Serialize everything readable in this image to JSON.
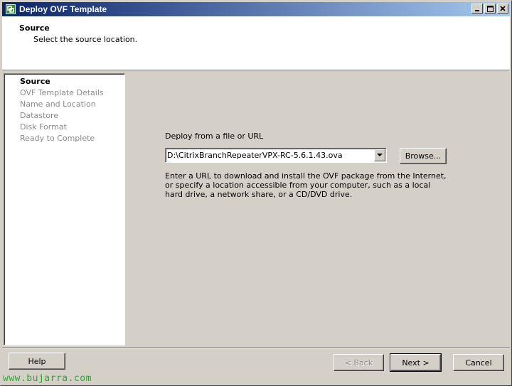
{
  "window": {
    "title": "Deploy OVF Template",
    "icon": "ovf-deploy-icon",
    "controls": [
      "minimize",
      "maximize",
      "close"
    ]
  },
  "header": {
    "title": "Source",
    "subtitle": "Select the source location."
  },
  "steps": [
    {
      "label": "Source",
      "active": true
    },
    {
      "label": "OVF Template Details",
      "active": false
    },
    {
      "label": "Name and Location",
      "active": false
    },
    {
      "label": "Datastore",
      "active": false
    },
    {
      "label": "Disk Format",
      "active": false
    },
    {
      "label": "Ready to Complete",
      "active": false
    }
  ],
  "main": {
    "deploy_label": "Deploy from a file or URL",
    "source_value": "D:\\CitrixBranchRepeaterVPX-RC-5.6.1.43.ova",
    "browse_label": "Browse...",
    "description": "Enter a URL to download and install the OVF package from the Internet, or specify a location accessible from your computer, such as a local hard drive, a network share, or a CD/DVD drive."
  },
  "footer": {
    "help_label": "Help",
    "back_label": "< Back",
    "next_label": "Next >",
    "cancel_label": "Cancel"
  },
  "watermark": "www.bujarra.com"
}
